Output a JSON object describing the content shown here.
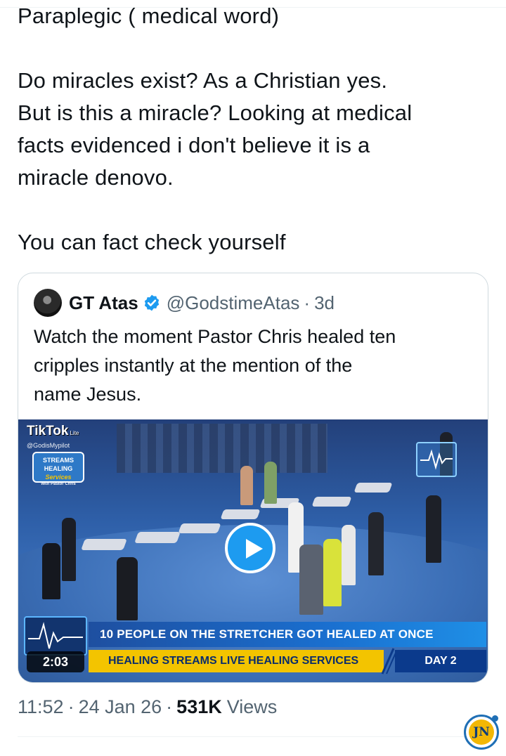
{
  "tweet": {
    "lines": [
      "Paraplegic ( medical word)",
      "",
      "Do miracles exist? As a Christian yes.",
      "But is this a miracle? Looking at medical",
      "facts evidenced i don't  believe it is a",
      "miracle denovo.",
      "",
      "You can fact check yourself"
    ]
  },
  "quote": {
    "author_name": "GT Atas",
    "handle": "@GodstimeAtas",
    "dot": "·",
    "time": "3d",
    "body_lines": [
      "Watch the moment Pastor Chris healed ten",
      "cripples instantly at the mention of the",
      "name Jesus."
    ],
    "video": {
      "tiktok_label": "TikTok",
      "tiktok_sub": "Lite",
      "tiktok_handle": "@GodisMypilot",
      "logo_lines": [
        "STREAMS",
        "HEALING",
        "Services",
        "with Pastor Chris"
      ],
      "headline": "10 PEOPLE ON THE STRETCHER GOT HEALED AT ONCE",
      "subline": "HEALING STREAMS LIVE HEALING SERVICES",
      "day": "DAY 2",
      "duration": "2:03"
    }
  },
  "meta": {
    "time": "11:52",
    "dot1": "·",
    "date": "24 Jan 26",
    "dot2": "·",
    "views_count": "531K",
    "views_label": "Views"
  },
  "watermark": {
    "text": "JN"
  },
  "colors": {
    "accent": "#1d9bf0",
    "secondary_text": "#536471",
    "border": "#cfd9de"
  }
}
